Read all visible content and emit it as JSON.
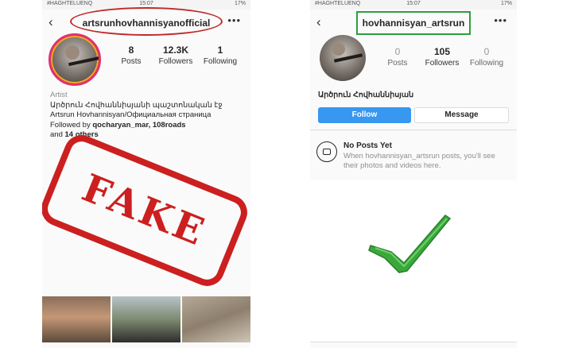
{
  "left": {
    "status": {
      "carrier": "#HAGHTELUENQ",
      "time": "15:07",
      "battery": "17%"
    },
    "username": "artsrunhovhannisyanofficial",
    "stats": [
      {
        "value": "8",
        "label": "Posts"
      },
      {
        "value": "12.3K",
        "label": "Followers"
      },
      {
        "value": "1",
        "label": "Following"
      }
    ],
    "bio": {
      "category": "Artist",
      "line1": "Արծրուն Հովհաննիսյանի պաշտոնական էջ",
      "line2": "Artsrun Hovhannisyan/Официальная страница",
      "followed_prefix": "Followed by",
      "followed_names": "qocharyan_mar, 108roads",
      "and_text": "and",
      "others": "14 others"
    },
    "stamp_text": "FAKE",
    "highlight_color": "#c12a2a"
  },
  "right": {
    "status": {
      "carrier": "#HAGHTELUENQ",
      "time": "15:07",
      "battery": "17%"
    },
    "username": "hovhannisyan_artsrun",
    "stats": [
      {
        "value": "0",
        "label": "Posts"
      },
      {
        "value": "105",
        "label": "Followers"
      },
      {
        "value": "0",
        "label": "Following"
      }
    ],
    "display_name": "Արծրուն Հովհաննիսյան",
    "follow_label": "Follow",
    "message_label": "Message",
    "no_posts_title": "No Posts Yet",
    "no_posts_text": "When hovhannisyan_artsrun posts, you'll see their photos and videos here.",
    "highlight_color": "#2e9e3c"
  },
  "icons": {
    "back": "back-chevron-icon",
    "more": "more-dots-icon",
    "camera": "camera-icon",
    "check": "checkmark-icon"
  },
  "colors": {
    "stamp": "#cc1f1f",
    "follow": "#3897f0",
    "check": "#3aa83a"
  }
}
